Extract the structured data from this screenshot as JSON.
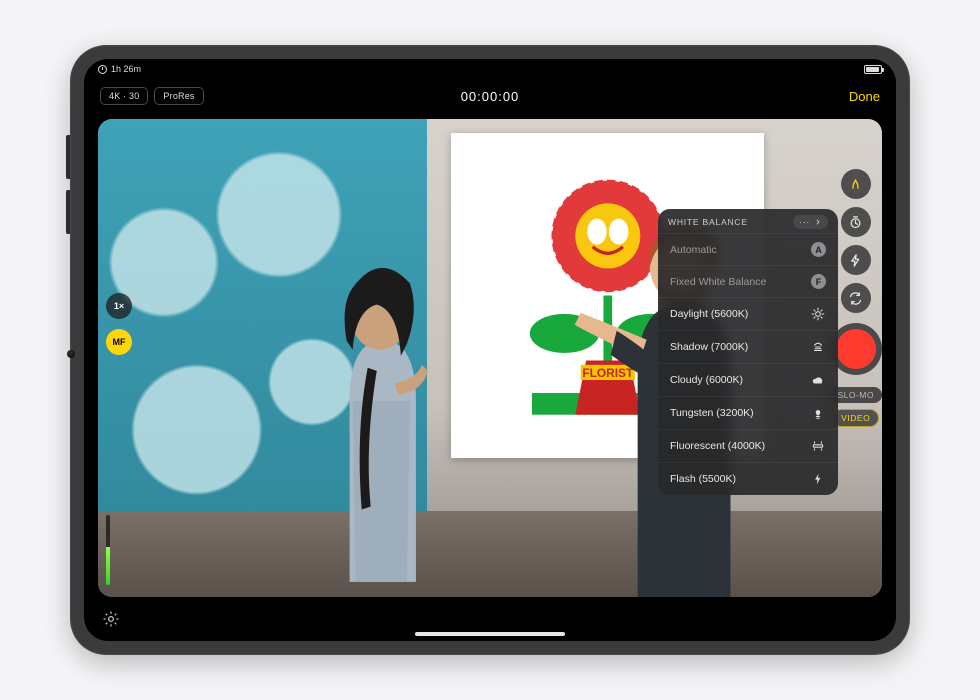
{
  "status": {
    "rec_remaining": "1h 26m"
  },
  "topbar": {
    "format_label": "4K · 30",
    "codec_label": "ProRes",
    "timecode": "00:00:00",
    "done_label": "Done"
  },
  "viewfinder": {
    "zoom_label": "1×",
    "focus_label": "MF",
    "poster_text": "FLORIST"
  },
  "side": {
    "modes": {
      "slomo": "SLO-MO",
      "video": "VIDEO"
    }
  },
  "wb_panel": {
    "title": "WHITE BALANCE",
    "nav_label": "···",
    "items": [
      {
        "label": "Automatic",
        "badge": "A"
      },
      {
        "label": "Fixed White Balance",
        "badge": "F"
      },
      {
        "label": "Daylight (5600K)",
        "icon": "sun"
      },
      {
        "label": "Shadow (7000K)",
        "icon": "shadow"
      },
      {
        "label": "Cloudy (6000K)",
        "icon": "cloud"
      },
      {
        "label": "Tungsten (3200K)",
        "icon": "bulb"
      },
      {
        "label": "Fluorescent (4000K)",
        "icon": "tube"
      },
      {
        "label": "Flash (5500K)",
        "icon": "flash"
      }
    ]
  }
}
